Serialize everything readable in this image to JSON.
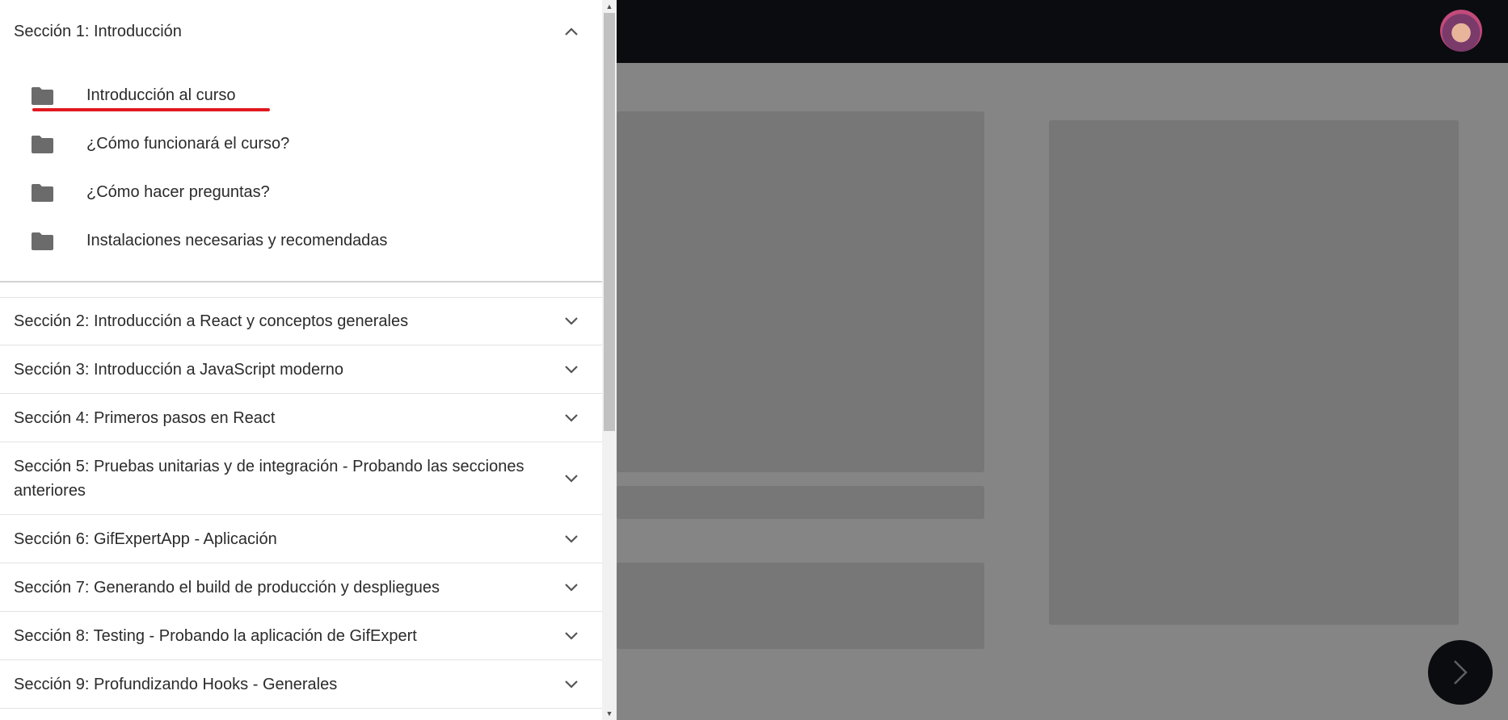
{
  "drawer": {
    "sections": [
      {
        "label": "Sección 1: Introducción",
        "expanded": true,
        "icon": "chevron-up-icon"
      },
      {
        "label": "Sección 2: Introducción a React y conceptos generales",
        "icon": "chevron-down-icon"
      },
      {
        "label": "Sección 3: Introducción a JavaScript moderno",
        "icon": "chevron-down-icon"
      },
      {
        "label": "Sección 4: Primeros pasos en React",
        "icon": "chevron-down-icon"
      },
      {
        "label": "Sección 5: Pruebas unitarias y de integración - Probando las secciones anteriores",
        "icon": "chevron-down-icon"
      },
      {
        "label": "Sección 6: GifExpertApp - Aplicación",
        "icon": "chevron-down-icon"
      },
      {
        "label": "Sección 7: Generando el build de producción y despliegues",
        "icon": "chevron-down-icon"
      },
      {
        "label": "Sección 8: Testing - Probando la aplicación de GifExpert",
        "icon": "chevron-down-icon"
      },
      {
        "label": "Sección 9: Profundizando Hooks - Generales",
        "icon": "chevron-down-icon"
      }
    ],
    "lessons": [
      {
        "label": "Introducción al curso",
        "icon": "folder-icon",
        "active": true
      },
      {
        "label": "¿Cómo funcionará el curso?",
        "icon": "folder-icon"
      },
      {
        "label": "¿Cómo hacer preguntas?",
        "icon": "folder-icon"
      },
      {
        "label": "Instalaciones necesarias y recomendadas",
        "icon": "folder-icon"
      }
    ]
  },
  "header": {
    "avatar": "avatar"
  },
  "fab": {
    "icon": "chevron-right-icon"
  },
  "colors": {
    "drawer_bg": "#ffffff",
    "backdrop": "#858585",
    "topbar": "#0b0c10",
    "active_underline": "#e0191f",
    "text": "#2b2b2b",
    "folder_icon": "#6b6b6b"
  }
}
